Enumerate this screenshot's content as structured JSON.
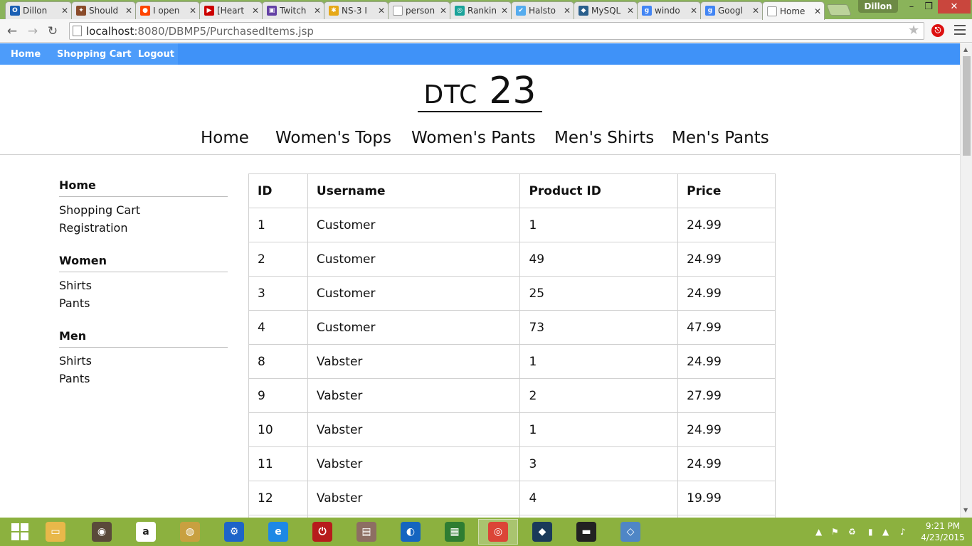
{
  "browser": {
    "tabs": [
      {
        "title": "Dillon",
        "color": "#1a5fb4",
        "glyph": "O"
      },
      {
        "title": "Should",
        "color": "#8a4b2a",
        "glyph": "✦"
      },
      {
        "title": "I open",
        "color": "#ff4500",
        "glyph": "●"
      },
      {
        "title": "[Heart",
        "color": "#cc0000",
        "glyph": "▶"
      },
      {
        "title": "Twitch",
        "color": "#6441a5",
        "glyph": "▣"
      },
      {
        "title": "NS-3 I",
        "color": "#e6a817",
        "glyph": "✱"
      },
      {
        "title": "person",
        "color": "#ffffff",
        "glyph": ""
      },
      {
        "title": "Rankin",
        "color": "#1aa39a",
        "glyph": "◎"
      },
      {
        "title": "Halsto",
        "color": "#55acee",
        "glyph": "✔"
      },
      {
        "title": "MySQL",
        "color": "#2a5f8c",
        "glyph": "◆"
      },
      {
        "title": "windo",
        "color": "#4285f4",
        "glyph": "g"
      },
      {
        "title": "Googl",
        "color": "#4285f4",
        "glyph": "g"
      },
      {
        "title": "Home",
        "color": "#ffffff",
        "glyph": ""
      }
    ],
    "profile_name": "Dillon",
    "url_host": "localhost",
    "url_path": ":8080/DBMP5/PurchasedItems.jsp"
  },
  "topbar": {
    "items": [
      "Home",
      "Shopping Cart",
      "Logout"
    ]
  },
  "brand": {
    "text": "DTC",
    "number": "23"
  },
  "main_nav": [
    "Home",
    "Women's Tops",
    "Women's Pants",
    "Men's Shirts",
    "Men's Pants"
  ],
  "sidebar": {
    "sections": [
      {
        "heading": "Home",
        "items": [
          "Shopping Cart",
          "Registration"
        ]
      },
      {
        "heading": "Women",
        "items": [
          "Shirts",
          "Pants"
        ]
      },
      {
        "heading": "Men",
        "items": [
          "Shirts",
          "Pants"
        ]
      }
    ]
  },
  "table": {
    "headers": [
      "ID",
      "Username",
      "Product ID",
      "Price"
    ],
    "rows": [
      [
        "1",
        "Customer",
        "1",
        "24.99"
      ],
      [
        "2",
        "Customer",
        "49",
        "24.99"
      ],
      [
        "3",
        "Customer",
        "25",
        "24.99"
      ],
      [
        "4",
        "Customer",
        "73",
        "47.99"
      ],
      [
        "8",
        "Vabster",
        "1",
        "24.99"
      ],
      [
        "9",
        "Vabster",
        "2",
        "27.99"
      ],
      [
        "10",
        "Vabster",
        "1",
        "24.99"
      ],
      [
        "11",
        "Vabster",
        "3",
        "24.99"
      ],
      [
        "12",
        "Vabster",
        "4",
        "19.99"
      ],
      [
        "",
        "",
        "",
        ""
      ]
    ]
  },
  "taskbar": {
    "apps": [
      {
        "name": "file-explorer-icon",
        "color": "#e8b84a",
        "glyph": "▭"
      },
      {
        "name": "speaker-app-icon",
        "color": "#5a4a3a",
        "glyph": "◉"
      },
      {
        "name": "amazon-icon",
        "color": "#ffffff",
        "glyph": "a"
      },
      {
        "name": "safe-app-icon",
        "color": "#c8a040",
        "glyph": "◍"
      },
      {
        "name": "settings-app-icon",
        "color": "#1e64c8",
        "glyph": "⚙"
      },
      {
        "name": "internet-explorer-icon",
        "color": "#1e88e5",
        "glyph": "e"
      },
      {
        "name": "power-app-icon",
        "color": "#b71c1c",
        "glyph": "⏻"
      },
      {
        "name": "document-app-icon",
        "color": "#8d6e63",
        "glyph": "▤"
      },
      {
        "name": "firefox-icon",
        "color": "#1565c0",
        "glyph": "◐"
      },
      {
        "name": "store-icon",
        "color": "#2e7d32",
        "glyph": "▦"
      },
      {
        "name": "chrome-icon",
        "color": "#db4437",
        "glyph": "◎"
      },
      {
        "name": "mysql-workbench-icon",
        "color": "#1a3a5a",
        "glyph": "◆"
      },
      {
        "name": "mysql-console-icon",
        "color": "#222222",
        "glyph": "▬"
      },
      {
        "name": "virtualbox-icon",
        "color": "#4f86c6",
        "glyph": "◇"
      }
    ],
    "time": "9:21 PM",
    "date": "4/23/2015"
  }
}
